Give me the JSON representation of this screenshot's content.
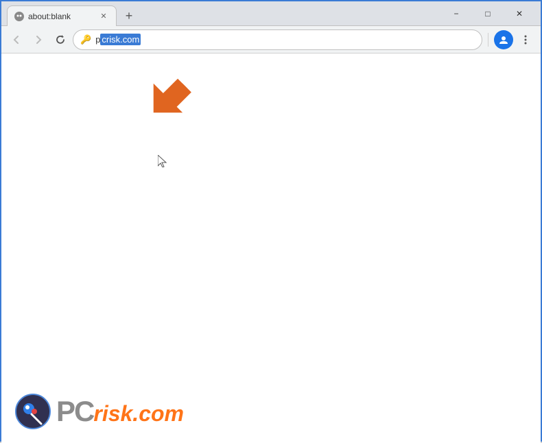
{
  "window": {
    "title": "about:blank",
    "border_color": "#3a7bd5"
  },
  "titlebar": {
    "tab_title": "about:blank",
    "new_tab_label": "+",
    "minimize_label": "−",
    "maximize_label": "□",
    "close_label": "✕"
  },
  "navbar": {
    "back_icon": "←",
    "forward_icon": "→",
    "reload_icon": "↻",
    "address_value_prefix": "p",
    "address_value_highlighted": "crisk.com",
    "lock_icon": "🔑",
    "profile_icon": "👤",
    "menu_icon": "⋮"
  },
  "content": {
    "background": "#ffffff"
  },
  "watermark": {
    "pc_text": "PC",
    "risk_text": "risk.com"
  },
  "colors": {
    "arrow_color": "#e06520",
    "accent": "#1a73e8",
    "tab_bg": "#f1f3f4",
    "titlebar_bg": "#dee1e6"
  }
}
